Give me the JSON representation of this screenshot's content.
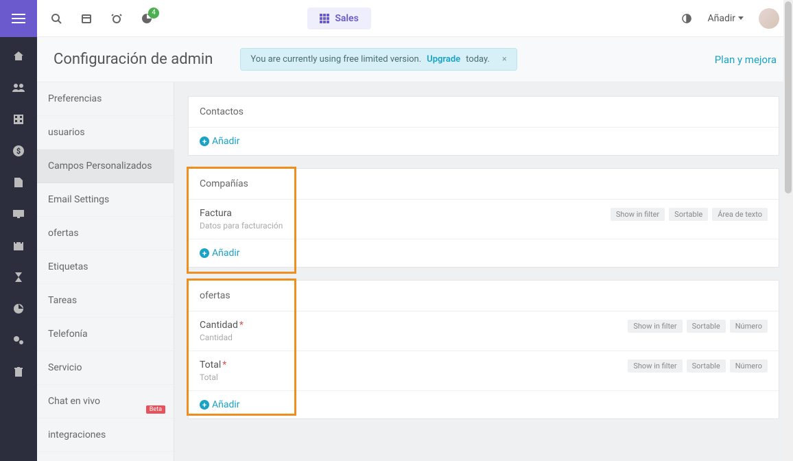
{
  "topbar": {
    "badge_count": "4",
    "center_label": "Sales",
    "add_label": "Añadir"
  },
  "header": {
    "title": "Configuración de admin",
    "alert_prefix": "You are currently using free limited version. ",
    "alert_link": "Upgrade",
    "alert_suffix": " today.",
    "plan_link": "Plan y mejora"
  },
  "sidebar": {
    "items": [
      {
        "label": "Preferencias"
      },
      {
        "label": "usuarios"
      },
      {
        "label": "Campos Personalizados",
        "active": true
      },
      {
        "label": "Email Settings"
      },
      {
        "label": "ofertas"
      },
      {
        "label": "Etiquetas"
      },
      {
        "label": "Tareas"
      },
      {
        "label": "Telefonía"
      },
      {
        "label": "Servicio"
      },
      {
        "label": "Chat en vivo",
        "beta": "Beta"
      },
      {
        "label": "integraciones"
      }
    ]
  },
  "panels": {
    "contacts": {
      "title": "Contactos",
      "add": "Añadir"
    },
    "companies": {
      "title": "Compañías",
      "rows": [
        {
          "name": "Factura",
          "desc": "Datos para facturación",
          "tags": [
            "Show in filter",
            "Sortable",
            "Área de texto"
          ]
        }
      ],
      "add": "Añadir"
    },
    "offers": {
      "title": "ofertas",
      "rows": [
        {
          "name": "Cantidad",
          "required": "*",
          "desc": "Cantidad",
          "tags": [
            "Show in filter",
            "Sortable",
            "Número"
          ]
        },
        {
          "name": "Total",
          "required": "*",
          "desc": "Total",
          "tags": [
            "Show in filter",
            "Sortable",
            "Número"
          ]
        }
      ],
      "add": "Añadir"
    }
  }
}
